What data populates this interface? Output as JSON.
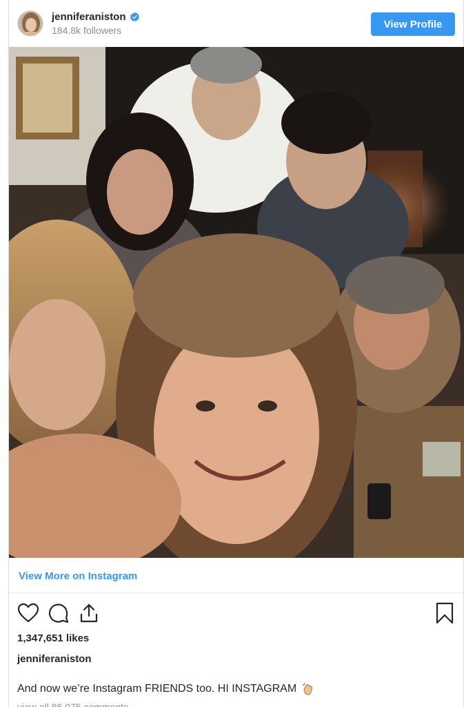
{
  "post": {
    "username": "jenniferaniston",
    "followers": "184.8k followers",
    "verified_icon": "verified-badge-icon",
    "view_profile_label": "View Profile",
    "view_more_label": "View More on Instagram",
    "likes": "1,347,651 likes",
    "caption_author": "jenniferaniston",
    "caption_text": "And now we’re Instagram FRIENDS too. HI INSTAGRAM",
    "comments_peek": "view all 86,075 comments"
  },
  "icons": {
    "like": "heart-icon",
    "comment": "comment-icon",
    "share": "share-icon",
    "save": "bookmark-icon",
    "emoji": "waving-hand-icon"
  },
  "colors": {
    "accent": "#3897f0",
    "text": "#262626",
    "muted": "#8e8e8e"
  }
}
